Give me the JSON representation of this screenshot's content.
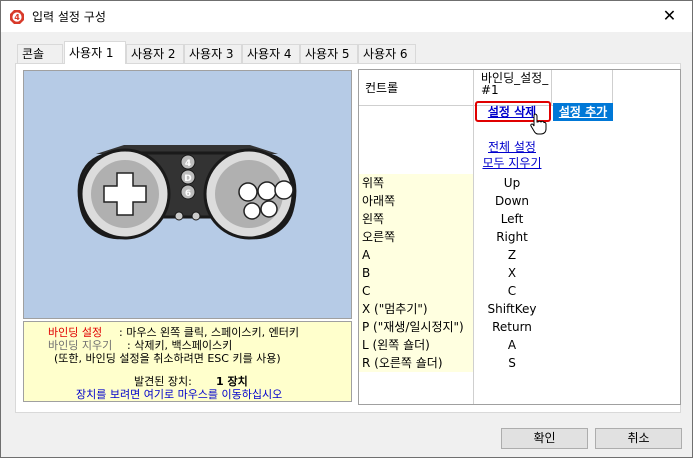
{
  "window": {
    "title": "입력 설정 구성",
    "close_glyph": "✕",
    "icon": "app-icon-red-4"
  },
  "tabs": [
    "콘솔",
    "사용자 1",
    "사용자 2",
    "사용자 3",
    "사용자 4",
    "사용자 5",
    "사용자 6"
  ],
  "active_tab": "사용자 1",
  "info": {
    "line1_key": "바인딩 설정",
    "line1_val": "  : 마우스 왼쪽 클릭, 스페이스키, 엔터키",
    "line2_key": "바인딩 지우기",
    "line2_val": " : 삭제키, 백스페이스키",
    "line3": "(또한, 바인딩 설정을 취소하려면 ESC 키를 사용)",
    "found_label": "발견된 장치: ",
    "found_value": "1 장치",
    "hint": "장치를 보려면 여기로 마우스를 이동하십시오"
  },
  "pad_buttons": {
    "top": "4",
    "middle": "D",
    "bottom": "6"
  },
  "grid": {
    "header_label": "컨트롤",
    "header_binding": "바인딩_설정_#1",
    "delete_link": "설정 삭제",
    "add_link": "설정 추가",
    "clear_all_1": "전체 설정",
    "clear_all_2": "모두 지우기",
    "rows": [
      {
        "control": "위쪽",
        "binding": "Up"
      },
      {
        "control": "아래쪽",
        "binding": "Down"
      },
      {
        "control": "왼쪽",
        "binding": "Left"
      },
      {
        "control": "오른쪽",
        "binding": "Right"
      },
      {
        "control": "A",
        "binding": "Z"
      },
      {
        "control": "B",
        "binding": "X"
      },
      {
        "control": "C",
        "binding": "C"
      },
      {
        "control": "X (\"멈추기\")",
        "binding": "ShiftKey"
      },
      {
        "control": "P (\"재생/일시정지\")",
        "binding": "Return"
      },
      {
        "control": "L (왼쪽 숄더)",
        "binding": "A"
      },
      {
        "control": "R (오른쪽 숄더)",
        "binding": "S"
      }
    ]
  },
  "buttons": {
    "ok": "확인",
    "cancel": "취소"
  },
  "colors": {
    "accent_red": "#e00000",
    "link_blue": "#0000cc",
    "add_bg": "#0078d7",
    "pad_bg": "#b6cbe6",
    "info_bg": "#ffffcc"
  }
}
